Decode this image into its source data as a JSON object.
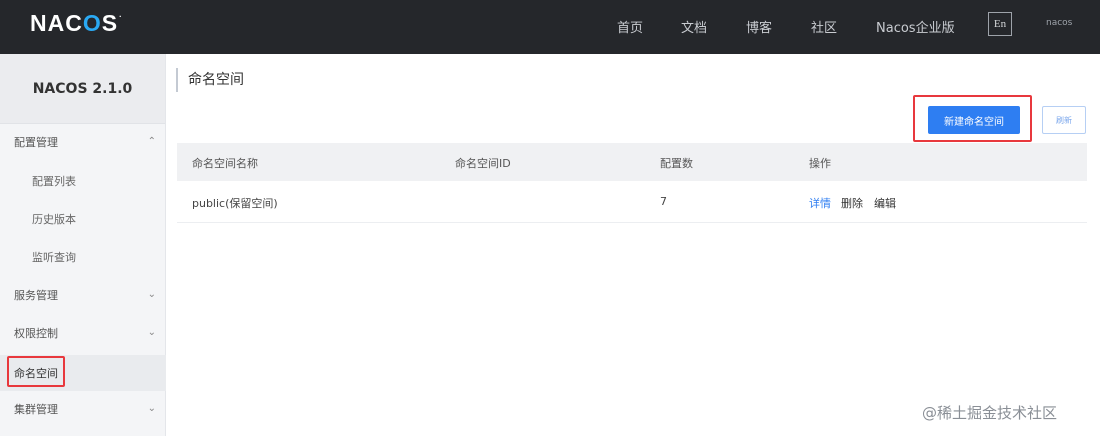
{
  "header": {
    "logo": {
      "prefix": "NAC",
      "accent": "O",
      "suffix": "S",
      "mark": "."
    },
    "nav": [
      "首页",
      "文档",
      "博客",
      "社区",
      "Nacos企业版"
    ],
    "lang_button": "En",
    "username": "nacos"
  },
  "sidebar": {
    "version": "NACOS 2.1.0",
    "groups": [
      {
        "label": "配置管理",
        "expanded": true,
        "children": [
          "配置列表",
          "历史版本",
          "监听查询"
        ]
      },
      {
        "label": "服务管理",
        "expanded": false
      },
      {
        "label": "权限控制",
        "expanded": false
      },
      {
        "label": "命名空间",
        "active": true
      },
      {
        "label": "集群管理",
        "expanded": false
      }
    ],
    "icons": {
      "expanded": "chevron-up-icon",
      "collapsed": "chevron-down-icon"
    }
  },
  "main": {
    "title": "命名空间",
    "buttons": {
      "create": "新建命名空间",
      "refresh": "刷新"
    },
    "table": {
      "headers": [
        "命名空间名称",
        "命名空间ID",
        "配置数",
        "操作"
      ],
      "rows": [
        {
          "name": "public(保留空间)",
          "id": "",
          "count": "7",
          "ops": [
            "详情",
            "删除",
            "编辑"
          ]
        }
      ]
    }
  },
  "watermark": "@稀土掘金技术社区",
  "colors": {
    "topbar": "#25272b",
    "primary": "#2e7ef2",
    "highlight_box": "#e8383d",
    "link": "#2e7ef2"
  }
}
